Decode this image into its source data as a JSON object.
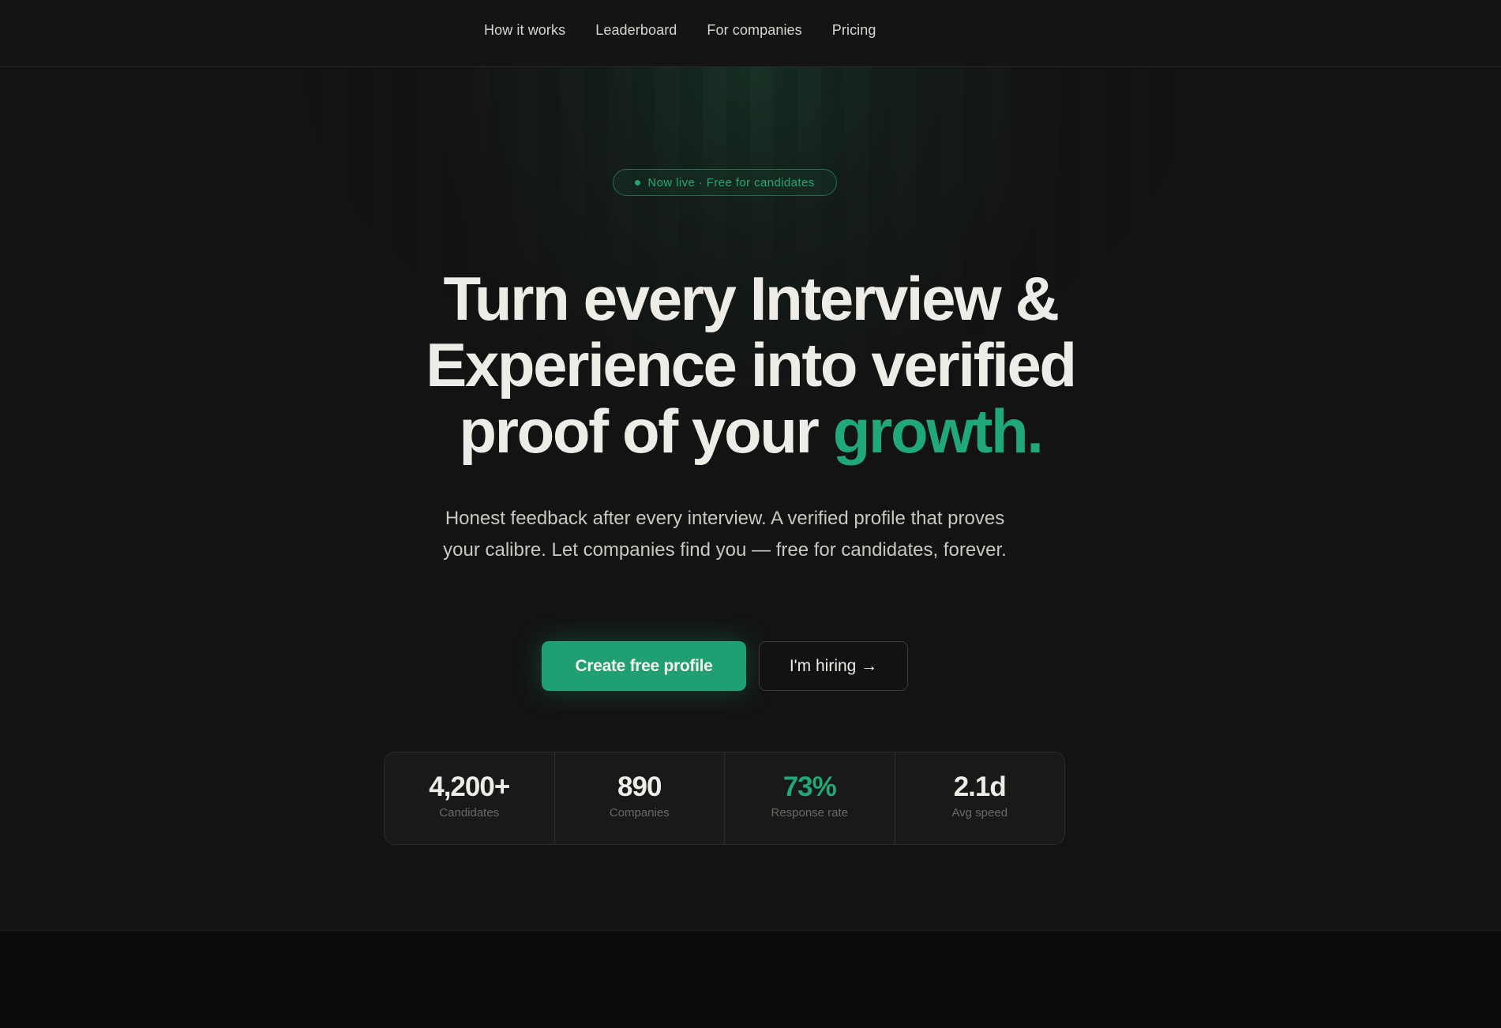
{
  "nav": {
    "links": [
      "How it works",
      "Leaderboard",
      "For companies",
      "Pricing"
    ]
  },
  "hero": {
    "badge": "Now live · Free for candidates",
    "headline": {
      "line1": "Turn every Interview &",
      "line2": "Experience into verified",
      "line3_prefix": "proof of your ",
      "line3_accent": "growth."
    },
    "subtext": "Honest feedback after every interview. A verified profile that proves your calibre. Let companies find you — free for candidates, forever.",
    "primary_cta": "Create free profile",
    "secondary_cta": "I'm hiring →"
  },
  "stats": [
    {
      "value": "4,200+",
      "label": "Candidates"
    },
    {
      "value": "890",
      "label": "Companies"
    },
    {
      "value": "73%",
      "label": "Response rate"
    },
    {
      "value": "2.1d",
      "label": "Avg speed"
    }
  ],
  "colors": {
    "accent": "#1f9f72",
    "background": "#131313"
  }
}
